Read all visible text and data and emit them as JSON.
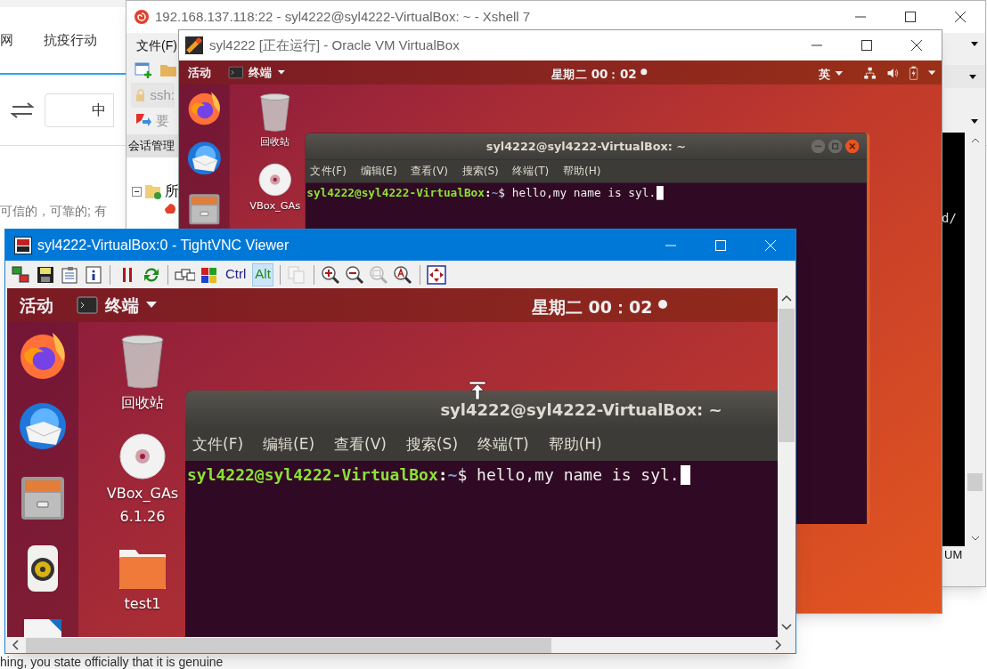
{
  "browser_page": {
    "nav_items": [
      "网",
      "抗疫行动"
    ],
    "language_field": "中",
    "text_line": "可信的，可靠的; 有",
    "bottom_text": "hing, you state officially that it is genuine"
  },
  "xshell": {
    "title": "192.168.137.118:22 - syl4222@syl4222-VirtualBox: ~ - Xshell 7",
    "menu": [
      "文件(F)"
    ],
    "address": "ssh:",
    "notice": "要",
    "panel_title": "会话管理",
    "tree_item": "所",
    "terminal_text": "d/",
    "status_text": "UM"
  },
  "virtualbox": {
    "title": "syl4222 [正在运行] - Oracle VM VirtualBox",
    "guest": {
      "activities": "活动",
      "app_menu": "终端",
      "clock": "星期二 00：02",
      "notification_dot": true,
      "input_method": "英",
      "status_icons": true,
      "dock": [
        {
          "kind": "browser"
        },
        {
          "kind": "mail"
        },
        {
          "kind": "files"
        }
      ],
      "desktop_icons": [
        {
          "kind": "trash",
          "lines": [
            "回收站"
          ]
        },
        {
          "kind": "disc",
          "lines": [
            "VBox_GAs"
          ]
        }
      ],
      "terminal": {
        "title": "syl4222@syl4222-VirtualBox: ~",
        "menu": [
          "文件(F)",
          "编辑(E)",
          "查看(V)",
          "搜索(S)",
          "终端(T)",
          "帮助(H)"
        ],
        "user": "syl4222@syl4222-VirtualBox",
        "separator": ":",
        "path": "~",
        "symbol": "$",
        "command": "hello,my name is syl.",
        "window_buttons": true
      }
    }
  },
  "vnc": {
    "title": "syl4222-VirtualBox:0 - TightVNC Viewer",
    "toolbar": [
      {
        "kind": "connections",
        "disabled": false
      },
      {
        "kind": "save",
        "disabled": false
      },
      {
        "kind": "options",
        "disabled": false
      },
      {
        "kind": "info",
        "disabled": false
      },
      {
        "kind": "separator"
      },
      {
        "kind": "pause",
        "disabled": false
      },
      {
        "kind": "refresh",
        "disabled": false
      },
      {
        "kind": "separator"
      },
      {
        "kind": "keys",
        "disabled": false
      },
      {
        "kind": "flag",
        "disabled": false
      },
      {
        "kind": "toggle",
        "label": "Ctrl",
        "selected": false,
        "disabled": false
      },
      {
        "kind": "toggle",
        "label": "Alt",
        "selected": true,
        "disabled": false
      },
      {
        "kind": "separator"
      },
      {
        "kind": "copy",
        "disabled": true
      },
      {
        "kind": "separator"
      },
      {
        "kind": "zoom_in",
        "disabled": false
      },
      {
        "kind": "zoom_out",
        "disabled": false
      },
      {
        "kind": "zoom_actual",
        "disabled": true
      },
      {
        "kind": "zoom_auto",
        "disabled": false
      },
      {
        "kind": "separator"
      },
      {
        "kind": "fullscreen",
        "disabled": false
      }
    ],
    "guest": {
      "activities": "活动",
      "app_menu": "终端",
      "clock": "星期二 00：02",
      "notification_dot": true,
      "pointer": true,
      "dock": [
        {
          "kind": "browser"
        },
        {
          "kind": "mail"
        },
        {
          "kind": "files"
        },
        {
          "kind": "speaker"
        },
        {
          "kind": "document"
        }
      ],
      "desktop_icons": [
        {
          "kind": "trash",
          "lines": [
            "回收站"
          ]
        },
        {
          "kind": "disc",
          "lines": [
            "VBox_GAs",
            "6.1.26"
          ]
        },
        {
          "kind": "folder",
          "lines": [
            "test1"
          ]
        }
      ],
      "terminal": {
        "title": "syl4222@syl4222-VirtualBox: ~",
        "menu": [
          "文件(F)",
          "编辑(E)",
          "查看(V)",
          "搜索(S)",
          "终端(T)",
          "帮助(H)"
        ],
        "user": "syl4222@syl4222-VirtualBox",
        "separator": ":",
        "path": "~",
        "symbol": "$",
        "command": "hello,my name is syl."
      }
    }
  }
}
